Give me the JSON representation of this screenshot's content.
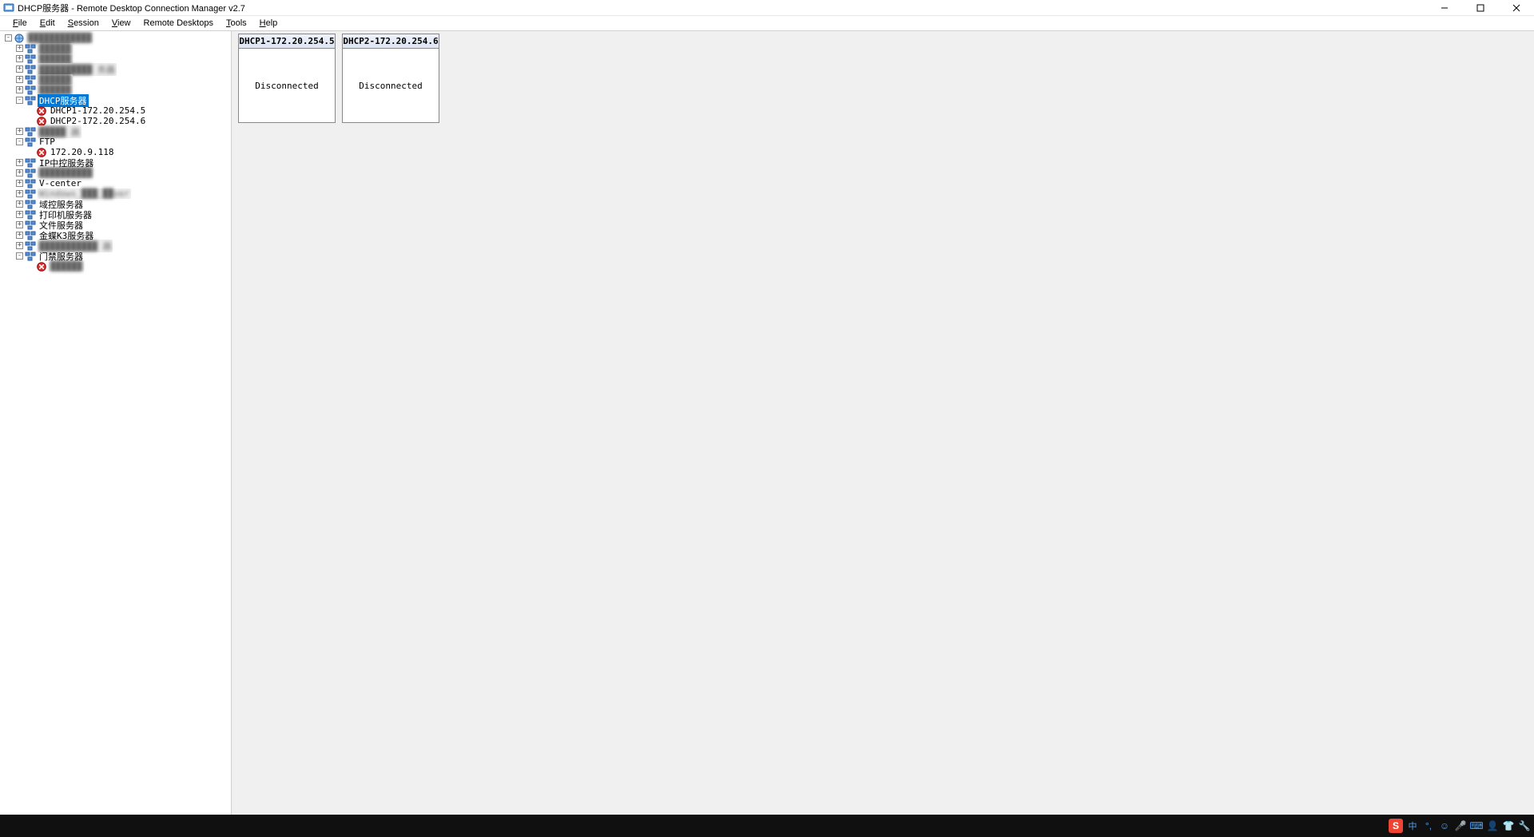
{
  "window": {
    "title": "DHCP服务器 - Remote Desktop Connection Manager v2.7"
  },
  "menu": {
    "file": "File",
    "edit": "Edit",
    "session": "Session",
    "view": "View",
    "remote_desktops": "Remote Desktops",
    "tools": "Tools",
    "help": "Help"
  },
  "tree": {
    "root_blur": "████████████",
    "groups": [
      {
        "label": "██████",
        "blur": true,
        "exp": "+",
        "indent": 1
      },
      {
        "label": "██████",
        "blur": true,
        "exp": "+",
        "indent": 1
      },
      {
        "label": "██████████ 务器",
        "blur": true,
        "exp": "+",
        "indent": 1
      },
      {
        "label": "██████",
        "blur": true,
        "exp": "+",
        "indent": 1
      },
      {
        "label": "██████",
        "blur": true,
        "exp": "+",
        "indent": 1
      },
      {
        "label": "DHCP服务器",
        "selected": true,
        "exp": "-",
        "indent": 1,
        "children": [
          {
            "label": "DHCP1-172.20.254.5",
            "icon": "disconnected",
            "indent": 2
          },
          {
            "label": "DHCP2-172.20.254.6",
            "icon": "disconnected",
            "indent": 2
          }
        ]
      },
      {
        "label": "█████ 器",
        "blur": true,
        "exp": "+",
        "indent": 1
      },
      {
        "label": "FTP",
        "exp": "-",
        "indent": 1,
        "children": [
          {
            "label": "172.20.9.118",
            "icon": "disconnected",
            "indent": 2
          }
        ]
      },
      {
        "label": "IP中控服务器",
        "exp": "+",
        "indent": 1
      },
      {
        "label": "██████████",
        "blur": true,
        "exp": "+",
        "indent": 1
      },
      {
        "label": "V-center",
        "exp": "+",
        "indent": 1
      },
      {
        "label": "Windows_███_██ver",
        "blur": true,
        "exp": "+",
        "indent": 1
      },
      {
        "label": "域控服务器",
        "exp": "+",
        "indent": 1
      },
      {
        "label": "打印机服务器",
        "exp": "+",
        "indent": 1
      },
      {
        "label": "文件服务器",
        "exp": "+",
        "indent": 1
      },
      {
        "label": "金蝶K3服务器",
        "exp": "+",
        "indent": 1
      },
      {
        "label": "███████████ 器",
        "blur": true,
        "exp": "+",
        "indent": 1
      },
      {
        "label": "门禁服务器",
        "exp": "-",
        "indent": 1,
        "children": [
          {
            "label": "██████",
            "blur": true,
            "icon": "disconnected",
            "indent": 2
          }
        ]
      }
    ]
  },
  "thumbnails": [
    {
      "title": "DHCP1-172.20.254.5",
      "status": "Disconnected"
    },
    {
      "title": "DHCP2-172.20.254.6",
      "status": "Disconnected"
    }
  ],
  "tray": {
    "sogou": "S",
    "ime": "中"
  }
}
